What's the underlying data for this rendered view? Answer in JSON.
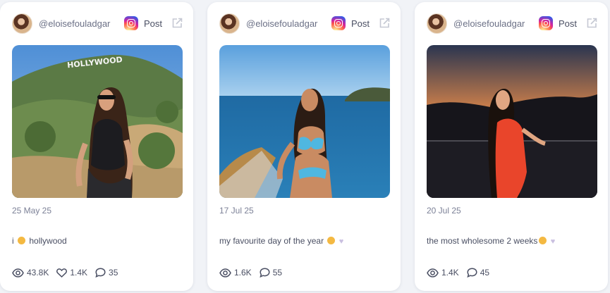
{
  "cards": [
    {
      "username": "@eloisefouladgar",
      "platform_icon": "instagram-icon",
      "post_label": "Post",
      "date": "25 May 25",
      "caption_start": "i",
      "caption_end": "hollywood",
      "photo_sign_text": "HOLLYWOOD",
      "views": "43.8K",
      "likes": "1.4K",
      "comments": "35"
    },
    {
      "username": "@eloisefouladgar",
      "platform_icon": "instagram-icon",
      "post_label": "Post",
      "date": "17 Jul 25",
      "caption": "my favourite day of the year",
      "views": "1.6K",
      "comments": "55"
    },
    {
      "username": "@eloisefouladgar",
      "platform_icon": "instagram-icon",
      "post_label": "Post",
      "date": "20 Jul 25",
      "caption": "the most wholesome 2 weeks",
      "views": "1.4K",
      "comments": "45"
    }
  ],
  "colors": {
    "background": "#f1f3f7",
    "card": "#ffffff",
    "text": "#4a4f63",
    "muted": "#7c8197"
  }
}
